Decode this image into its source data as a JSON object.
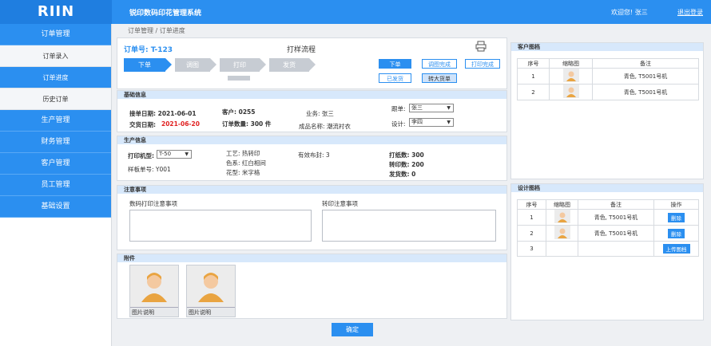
{
  "header": {
    "logo": "RIIN",
    "app_title": "锐印数码印花管理系统",
    "welcome": "欢迎您! 张三",
    "logout": "退出登录"
  },
  "sidebar": {
    "items": [
      {
        "label": "订单管理"
      },
      {
        "label": "订单录入"
      },
      {
        "label": "订单进度"
      },
      {
        "label": "历史订单"
      },
      {
        "label": "生产管理"
      },
      {
        "label": "财务管理"
      },
      {
        "label": "客户管理"
      },
      {
        "label": "员工管理"
      },
      {
        "label": "基础设置"
      }
    ]
  },
  "breadcrumb": "订单管理 / 订单进度",
  "order": {
    "order_no_label": "订单号: T-123",
    "flow_title": "打样流程",
    "steps": [
      "下单",
      "调图",
      "打印",
      "发货"
    ],
    "action_buttons": [
      "下单",
      "调图完成",
      "打印完成",
      "已发货",
      "转大货单"
    ]
  },
  "basic": {
    "title": "基础信息",
    "order_date": "接单日期: 2021-06-01",
    "deliver_label": "交货日期:",
    "deliver_value": "2021-06-20",
    "customer": "客户: 0255",
    "quantity": "订单数量: 300 件",
    "business": "业务: 张三",
    "product": "成品名称: 潮流衬衣",
    "follow_label": "跟单:",
    "follow_value": "张三",
    "design_label": "设计:",
    "design_value": "李四"
  },
  "production": {
    "title": "生产信息",
    "printer_label": "打印机型:",
    "printer_value": "T-50",
    "sample_no": "样板单号: Y001",
    "craft": "工艺: 热转印",
    "color": "色系: 红白相间",
    "pattern": "花型: 米字格",
    "effective": "有效布封: 3",
    "paper": "打纸数: 300",
    "transfer": "转印数: 200",
    "shipped": "发货数: 0"
  },
  "notes": {
    "title": "注意事项",
    "print_label": "数码打印注意事项",
    "transfer_label": "转印注意事项"
  },
  "attachments": {
    "title": "附件",
    "captions": [
      "图片说明",
      "图片说明"
    ]
  },
  "customer_files": {
    "title": "客户图档",
    "headers": [
      "序号",
      "缩略图",
      "备注"
    ],
    "rows": [
      {
        "no": "1",
        "note": "青色, T5001号机"
      },
      {
        "no": "2",
        "note": "青色, T5001号机"
      }
    ]
  },
  "design_files": {
    "title": "设计图档",
    "headers": [
      "序号",
      "缩略图",
      "备注",
      "操作"
    ],
    "rows": [
      {
        "no": "1",
        "note": "青色, T5001号机",
        "action": "删除"
      },
      {
        "no": "2",
        "note": "青色, T5001号机",
        "action": "删除"
      },
      {
        "no": "3",
        "note": "",
        "action": "上传图档"
      }
    ]
  },
  "confirm": "确定",
  "colors": {
    "primary": "#2b8ff0",
    "accent_red": "#e02020",
    "inactive_step": "#c7ccd3"
  }
}
